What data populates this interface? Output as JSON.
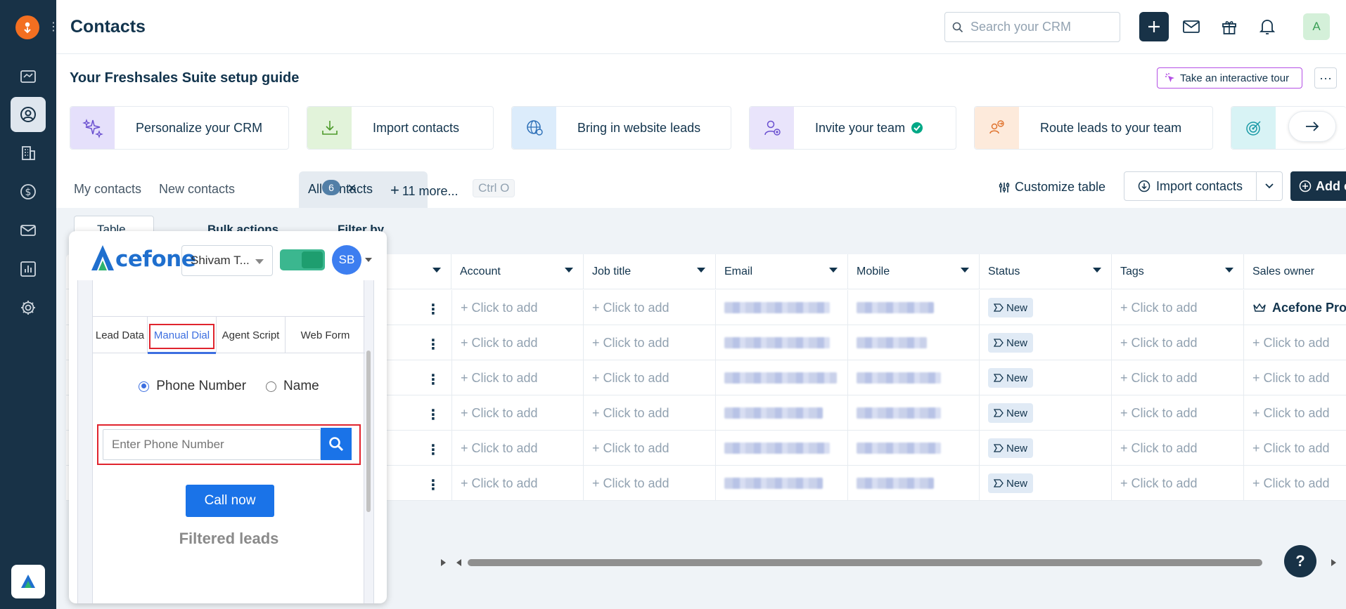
{
  "header": {
    "title": "Contacts",
    "search_placeholder": "Search your CRM",
    "avatar_initial": "A"
  },
  "setup_guide": {
    "title": "Your Freshsales Suite setup guide",
    "tour_label": "Take an interactive tour",
    "more_label": "···",
    "cards": [
      {
        "label": "Personalize your CRM"
      },
      {
        "label": "Import contacts"
      },
      {
        "label": "Bring in website leads"
      },
      {
        "label": "Invite your team"
      },
      {
        "label": "Route leads to your team"
      }
    ]
  },
  "tabs": {
    "my_contacts": "My contacts",
    "new_contacts": "New contacts",
    "all_contacts": "All contacts",
    "all_count": "6",
    "more": "11 more...",
    "shortcut": "Ctrl O"
  },
  "actions": {
    "customize": "Customize table",
    "import": "Import contacts",
    "add": "Add contact"
  },
  "toolbar": {
    "table": "Table",
    "bulk": "Bulk actions",
    "filter": "Filter by"
  },
  "table": {
    "columns": [
      "Account",
      "Job title",
      "Email",
      "Mobile",
      "Status",
      "Tags",
      "Sales owner"
    ],
    "placeholder": "+ Click to add",
    "status_value": "New",
    "first_owner": "Acefone Pro"
  },
  "widget": {
    "brand": "cefone",
    "agent": "Shivam T...",
    "avatar": "SB",
    "tabs": [
      "Lead Data",
      "Manual Dial",
      "Agent Script",
      "Web Form"
    ],
    "radio_phone": "Phone Number",
    "radio_name": "Name",
    "input_placeholder": "Enter Phone Number",
    "call_label": "Call now",
    "filtered_label": "Filtered leads"
  },
  "help_label": "?",
  "colors": {
    "sidebar": "#183247",
    "primary_dark": "#183247",
    "widget_blue": "#1a73e8",
    "highlight_red": "#e0242e"
  }
}
